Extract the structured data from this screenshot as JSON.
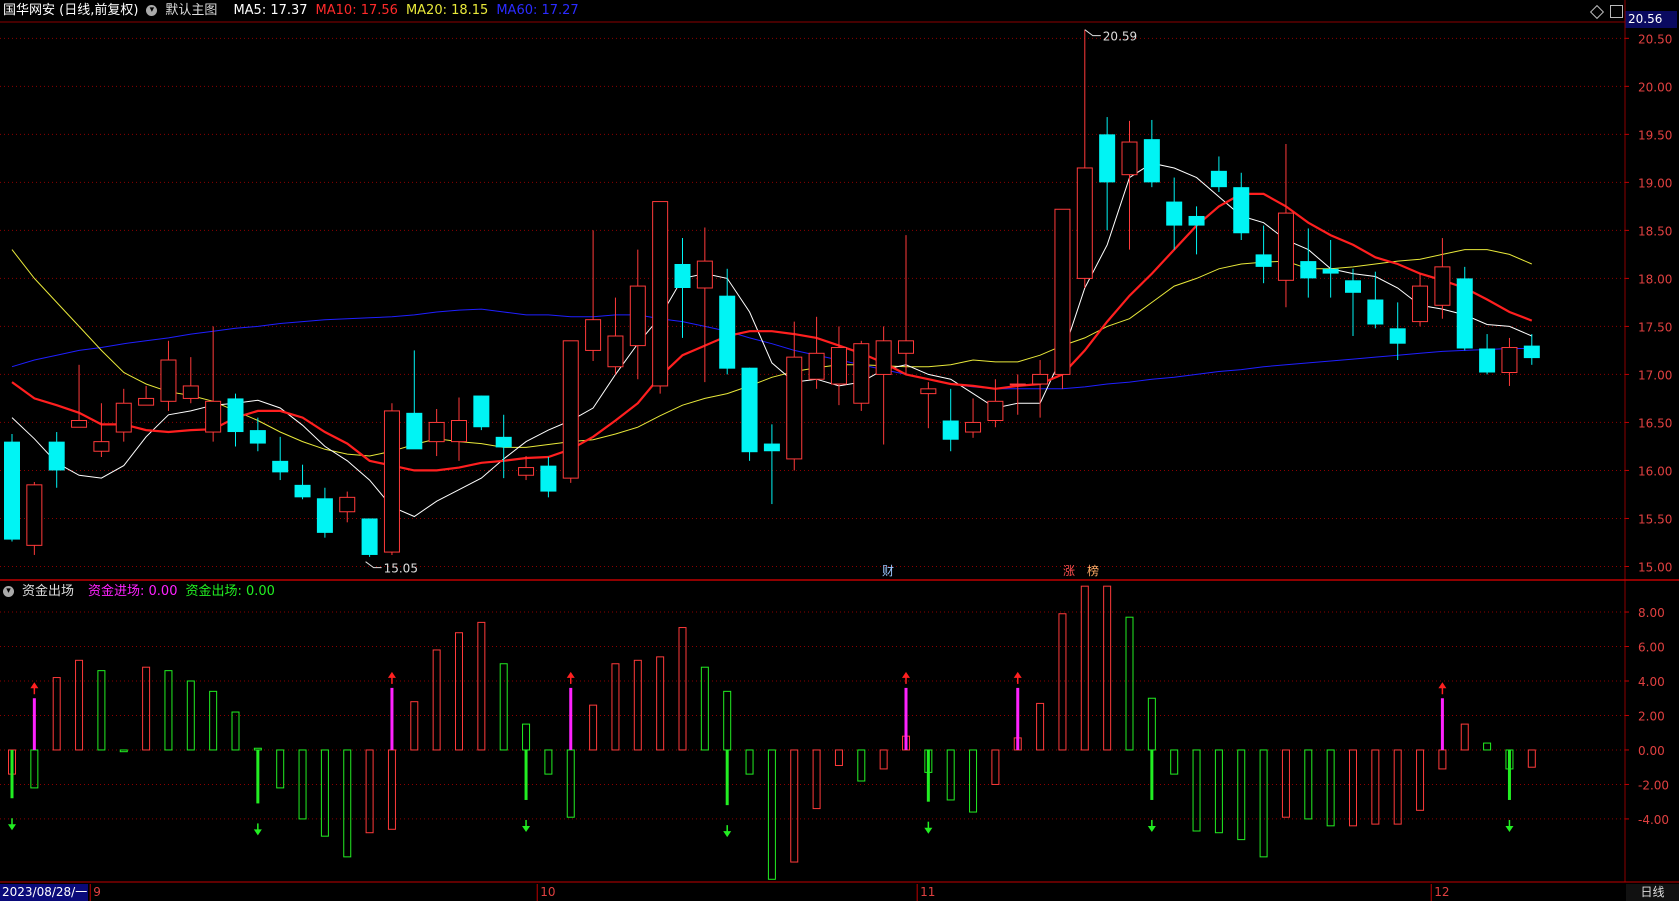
{
  "header": {
    "symbol": "国华网安 (日线,前复权)",
    "chart_name": "默认主图",
    "ma5": "MA5: 17.37",
    "ma10": "MA10: 17.56",
    "ma20": "MA20: 18.15",
    "ma60": "MA60: 17.27",
    "last_price": "20.56"
  },
  "indicator": {
    "name": "资金出场",
    "in_label": "资金进场: 0.00",
    "out_label": "资金出场: 0.00"
  },
  "footer": {
    "start_date": "2023/08/28/一",
    "period": "日线",
    "months": [
      "9",
      "10",
      "11",
      "12"
    ]
  },
  "annotations": {
    "high": "20.59",
    "low": "15.05",
    "event_tags": [
      "财",
      "涨",
      "榜"
    ]
  },
  "colors": {
    "up": "#ff3a3a",
    "down": "#00f4f4",
    "ma5": "#ffffff",
    "ma10": "#ff1f1f",
    "ma20": "#e8e83a",
    "ma60": "#1f1fff",
    "in": "#ff22ff",
    "out": "#22ee22",
    "grid": "#8b0000"
  },
  "chart_data": [
    {
      "type": "candlestick",
      "title": "国华网安 (日线,前复权)",
      "y_ticks": [
        "20.50",
        "20.00",
        "19.50",
        "19.00",
        "18.50",
        "18.00",
        "17.50",
        "17.00",
        "16.50",
        "16.00",
        "15.50",
        "15.00"
      ],
      "ylim": [
        14.88,
        20.67
      ],
      "month_starts": [
        4,
        24,
        41,
        64
      ],
      "candles": [
        [
          16.3,
          16.38,
          15.26,
          15.28
        ],
        [
          15.22,
          15.88,
          15.12,
          15.85
        ],
        [
          16.3,
          16.4,
          15.82,
          16.0
        ],
        [
          16.45,
          17.1,
          16.45,
          16.52
        ],
        [
          16.2,
          16.7,
          16.14,
          16.3
        ],
        [
          16.4,
          16.85,
          16.3,
          16.7
        ],
        [
          16.68,
          16.88,
          16.7,
          16.75
        ],
        [
          16.72,
          17.35,
          16.62,
          17.15
        ],
        [
          16.75,
          17.18,
          16.7,
          16.88
        ],
        [
          16.4,
          17.5,
          16.3,
          16.72
        ],
        [
          16.75,
          16.8,
          16.25,
          16.4
        ],
        [
          16.42,
          16.55,
          16.2,
          16.28
        ],
        [
          16.1,
          16.35,
          15.9,
          15.98
        ],
        [
          15.85,
          16.06,
          15.7,
          15.72
        ],
        [
          15.71,
          15.82,
          15.3,
          15.35
        ],
        [
          15.57,
          15.78,
          15.46,
          15.72
        ],
        [
          15.5,
          15.5,
          15.1,
          15.12
        ],
        [
          15.15,
          16.7,
          15.12,
          16.62
        ],
        [
          16.6,
          17.25,
          16.52,
          16.22
        ],
        [
          16.3,
          16.64,
          16.15,
          16.5
        ],
        [
          16.3,
          16.76,
          16.1,
          16.52
        ],
        [
          16.78,
          16.78,
          16.42,
          16.45
        ],
        [
          16.35,
          16.58,
          15.92,
          16.24
        ],
        [
          15.95,
          16.15,
          15.9,
          16.03
        ],
        [
          16.05,
          16.14,
          15.72,
          15.78
        ],
        [
          15.92,
          17.35,
          15.87,
          17.35
        ],
        [
          17.25,
          18.5,
          17.14,
          17.57
        ],
        [
          17.08,
          17.8,
          17.0,
          17.4
        ],
        [
          17.3,
          18.3,
          16.95,
          17.92
        ],
        [
          16.88,
          17.05,
          16.8,
          18.8
        ],
        [
          18.15,
          18.42,
          17.38,
          17.9
        ],
        [
          17.9,
          18.53,
          16.92,
          18.18
        ],
        [
          17.82,
          18.1,
          17.0,
          17.06
        ],
        [
          17.07,
          17.07,
          16.1,
          16.19
        ],
        [
          16.28,
          16.48,
          15.65,
          16.2
        ],
        [
          16.12,
          17.55,
          16.0,
          17.18
        ],
        [
          16.95,
          17.6,
          16.85,
          17.22
        ],
        [
          16.9,
          17.5,
          16.68,
          17.28
        ],
        [
          16.7,
          17.35,
          16.62,
          17.32
        ],
        [
          17.0,
          17.5,
          16.27,
          17.35
        ],
        [
          17.22,
          18.45,
          17.0,
          17.35
        ],
        [
          16.8,
          16.92,
          16.44,
          16.85
        ],
        [
          16.52,
          16.85,
          16.2,
          16.32
        ],
        [
          16.4,
          16.75,
          16.34,
          16.5
        ],
        [
          16.52,
          16.95,
          16.45,
          16.72
        ],
        [
          16.9,
          17.0,
          16.58,
          16.9
        ],
        [
          16.9,
          17.15,
          16.55,
          17.0
        ],
        [
          17.0,
          18.72,
          16.85,
          18.72
        ],
        [
          18.0,
          20.59,
          17.9,
          19.15
        ],
        [
          19.5,
          19.68,
          18.5,
          19.0
        ],
        [
          19.08,
          19.64,
          18.3,
          19.42
        ],
        [
          19.45,
          19.65,
          18.95,
          19.0
        ],
        [
          18.8,
          19.05,
          18.3,
          18.55
        ],
        [
          18.65,
          18.75,
          18.25,
          18.55
        ],
        [
          19.12,
          19.27,
          18.9,
          18.95
        ],
        [
          18.95,
          19.1,
          18.4,
          18.47
        ],
        [
          18.25,
          18.55,
          17.95,
          18.12
        ],
        [
          17.98,
          19.4,
          17.7,
          18.68
        ],
        [
          18.18,
          18.52,
          17.8,
          18.0
        ],
        [
          18.1,
          18.4,
          17.8,
          18.05
        ],
        [
          17.98,
          18.1,
          17.4,
          17.85
        ],
        [
          17.78,
          18.07,
          17.48,
          17.52
        ],
        [
          17.48,
          17.75,
          17.15,
          17.32
        ],
        [
          17.55,
          18.05,
          17.5,
          17.92
        ],
        [
          17.72,
          18.42,
          17.58,
          18.12
        ],
        [
          18.0,
          18.12,
          17.25,
          17.27
        ],
        [
          17.27,
          17.42,
          17.0,
          17.02
        ],
        [
          17.02,
          17.38,
          16.88,
          17.28
        ],
        [
          17.3,
          17.42,
          17.1,
          17.17
        ]
      ],
      "ma5": [
        16.55,
        16.33,
        16.08,
        15.95,
        15.92,
        16.05,
        16.35,
        16.58,
        16.62,
        16.68,
        16.7,
        16.73,
        16.65,
        16.47,
        16.25,
        16.1,
        15.9,
        15.62,
        15.52,
        15.68,
        15.8,
        15.92,
        16.12,
        16.3,
        16.42,
        16.52,
        16.65,
        17.0,
        17.32,
        17.6,
        18.0,
        18.05,
        18.0,
        17.65,
        17.12,
        16.92,
        16.95,
        16.88,
        16.92,
        17.05,
        17.1,
        17.0,
        16.95,
        16.8,
        16.65,
        16.7,
        16.7,
        17.2,
        17.9,
        18.35,
        19.05,
        19.2,
        19.15,
        19.05,
        18.85,
        18.65,
        18.58,
        18.4,
        18.3,
        18.1,
        18.05,
        18.02,
        17.9,
        17.72,
        17.68,
        17.62,
        17.52,
        17.5,
        17.4
      ],
      "ma10": [
        16.92,
        16.75,
        16.68,
        16.6,
        16.48,
        16.48,
        16.42,
        16.4,
        16.42,
        16.43,
        16.55,
        16.62,
        16.62,
        16.55,
        16.4,
        16.28,
        16.1,
        16.05,
        16.0,
        16.0,
        16.03,
        16.08,
        16.1,
        16.13,
        16.14,
        16.22,
        16.35,
        16.52,
        16.7,
        16.98,
        17.2,
        17.3,
        17.4,
        17.45,
        17.45,
        17.42,
        17.38,
        17.3,
        17.22,
        17.12,
        17.0,
        16.95,
        16.9,
        16.88,
        16.85,
        16.88,
        16.9,
        17.0,
        17.25,
        17.55,
        17.82,
        18.05,
        18.3,
        18.55,
        18.75,
        18.88,
        18.88,
        18.75,
        18.58,
        18.45,
        18.35,
        18.22,
        18.15,
        18.05,
        17.98,
        17.9,
        17.78,
        17.65,
        17.56
      ],
      "ma20": [
        18.3,
        18.0,
        17.75,
        17.5,
        17.25,
        17.02,
        16.9,
        16.82,
        16.78,
        16.72,
        16.62,
        16.52,
        16.4,
        16.3,
        16.22,
        16.17,
        16.15,
        16.2,
        16.27,
        16.33,
        16.3,
        16.28,
        16.24,
        16.24,
        16.27,
        16.3,
        16.32,
        16.38,
        16.45,
        16.57,
        16.68,
        16.75,
        16.8,
        16.88,
        16.97,
        17.03,
        17.07,
        17.1,
        17.1,
        17.09,
        17.08,
        17.08,
        17.1,
        17.15,
        17.13,
        17.13,
        17.2,
        17.3,
        17.38,
        17.5,
        17.58,
        17.75,
        17.92,
        18.0,
        18.1,
        18.15,
        18.17,
        18.18,
        18.1,
        18.1,
        18.12,
        18.15,
        18.18,
        18.2,
        18.25,
        18.3,
        18.3,
        18.25,
        18.15
      ],
      "ma60": [
        17.08,
        17.15,
        17.2,
        17.25,
        17.28,
        17.32,
        17.35,
        17.38,
        17.42,
        17.45,
        17.48,
        17.5,
        17.53,
        17.55,
        17.57,
        17.58,
        17.59,
        17.6,
        17.62,
        17.65,
        17.67,
        17.68,
        17.65,
        17.62,
        17.62,
        17.6,
        17.6,
        17.62,
        17.62,
        17.58,
        17.55,
        17.5,
        17.45,
        17.38,
        17.32,
        17.25,
        17.2,
        17.15,
        17.1,
        17.05,
        17.0,
        16.95,
        16.9,
        16.87,
        16.85,
        16.85,
        16.85,
        16.85,
        16.87,
        16.9,
        16.92,
        16.95,
        16.97,
        17.0,
        17.03,
        17.05,
        17.08,
        17.1,
        17.12,
        17.14,
        17.16,
        17.18,
        17.2,
        17.22,
        17.24,
        17.25,
        17.26,
        17.27,
        17.27
      ]
    },
    {
      "type": "bar",
      "title": "资金出场",
      "y_ticks": [
        "8.00",
        "6.00",
        "4.00",
        "2.00",
        "0.00",
        "-2.00",
        "-4.00"
      ],
      "ylim": [
        -7.6,
        9.8
      ],
      "bars": [
        -1.4,
        -2.2,
        4.2,
        5.2,
        4.6,
        -0.1,
        4.8,
        4.6,
        4.0,
        3.4,
        2.2,
        0.1,
        -2.2,
        -4.0,
        -5.0,
        -6.2,
        -4.8,
        -4.6,
        2.8,
        5.8,
        6.8,
        7.4,
        5.0,
        1.5,
        -1.4,
        -3.9,
        2.6,
        5.0,
        5.2,
        5.4,
        7.1,
        4.8,
        3.4,
        -1.4,
        -7.5,
        -6.5,
        -3.4,
        -0.9,
        -1.8,
        -1.1,
        0.8,
        -1.3,
        -2.9,
        -3.6,
        -2.0,
        0.7,
        2.7,
        7.9,
        9.5,
        9.5,
        7.7,
        3.0,
        -1.4,
        -4.7,
        -4.8,
        -5.2,
        -6.2,
        -3.9,
        -4.0,
        -4.4,
        -4.4,
        -4.3,
        -4.3,
        -3.5,
        -1.1,
        1.5,
        0.4,
        -1.1,
        -1.0
      ],
      "in_arrow_days": [
        1,
        17,
        25,
        40,
        45,
        64
      ],
      "in_values": [
        3.0,
        3.6,
        3.6,
        3.6,
        3.6,
        3.0
      ],
      "out_arrow_days": [
        0,
        11,
        23,
        32,
        41,
        51,
        67
      ],
      "out_values": [
        -2.8,
        -3.1,
        -2.9,
        -3.2,
        -3.0,
        -2.9,
        -2.9
      ]
    }
  ]
}
